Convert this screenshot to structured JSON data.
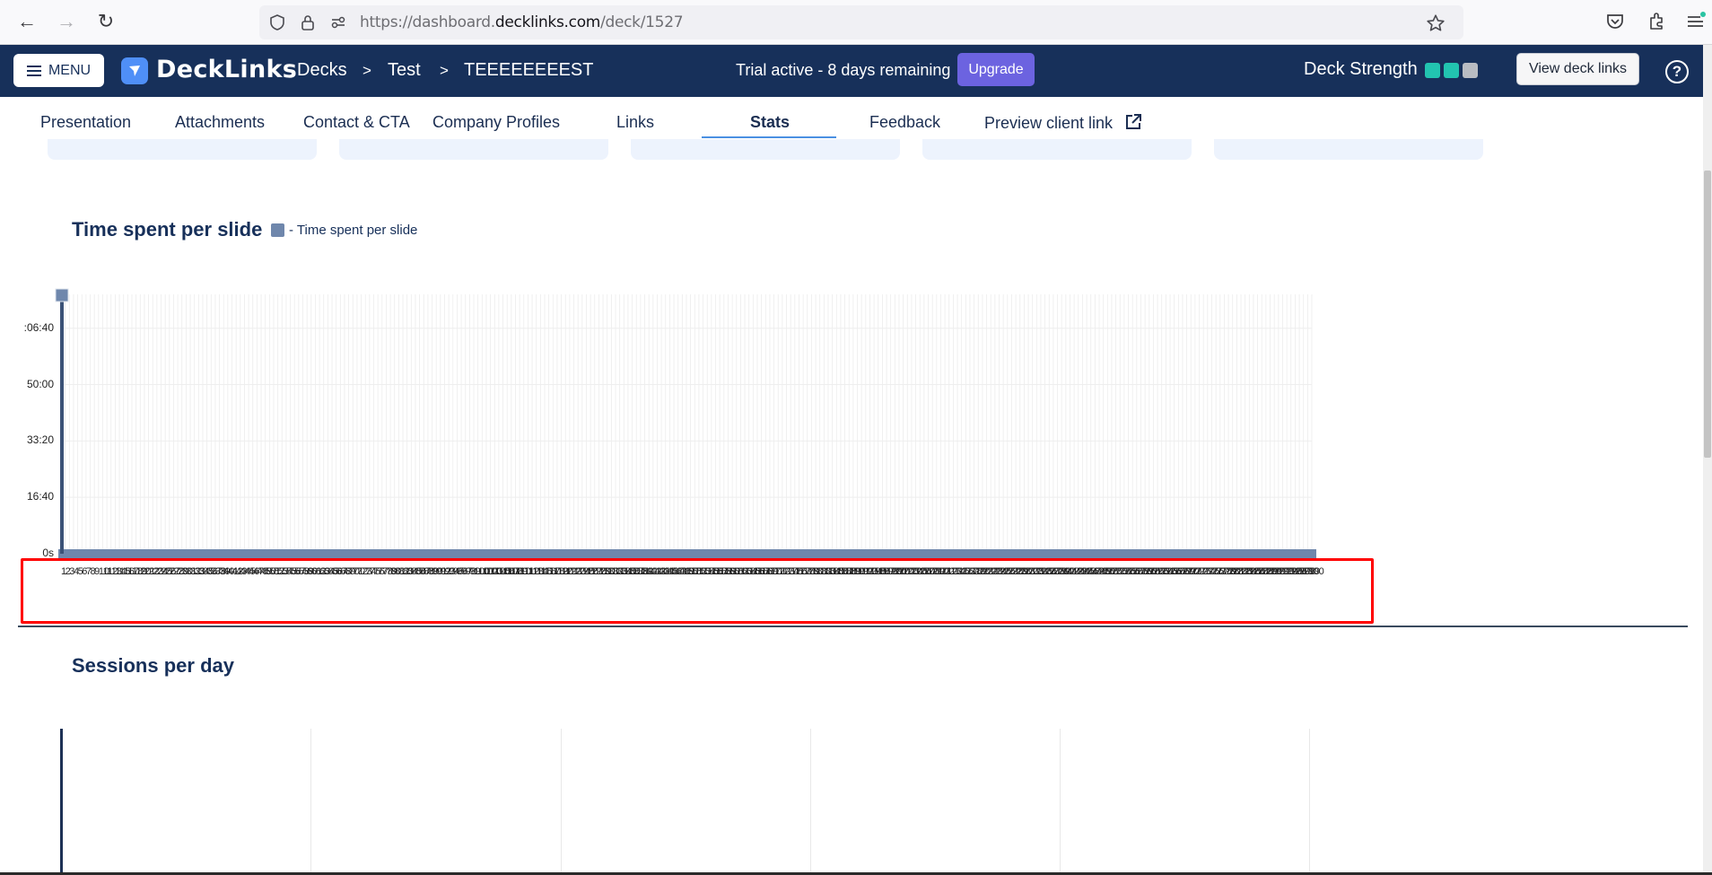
{
  "browser": {
    "url_prefix": "https://dashboard.",
    "url_domain": "decklinks.com",
    "url_path": "/deck/1527",
    "icons": [
      "back-icon",
      "forward-icon",
      "reload-icon",
      "shield-icon",
      "lock-icon",
      "permissions-icon",
      "bookmark-star-icon",
      "pocket-icon",
      "extensions-icon",
      "app-menu-icon"
    ]
  },
  "header": {
    "menu_label": "MENU",
    "logo_text": "DeckLinks",
    "breadcrumb": [
      "Decks",
      "Test",
      "TEEEEEEEEST"
    ],
    "breadcrumb_separator": ">",
    "trial_text": "Trial active - 8 days remaining",
    "upgrade_label": "Upgrade",
    "deck_strength_label": "Deck Strength",
    "deck_strength": {
      "filled": 2,
      "total": 3,
      "filled_color": "#22c4b0",
      "empty_color": "#b9bcc2"
    },
    "view_deck_links_label": "View deck links",
    "help_label": "?"
  },
  "tabs": [
    {
      "label": "Presentation",
      "active": false
    },
    {
      "label": "Attachments",
      "active": false
    },
    {
      "label": "Contact & CTA",
      "active": false
    },
    {
      "label": "Company Profiles",
      "active": false
    },
    {
      "label": "Links",
      "active": false
    },
    {
      "label": "Stats",
      "active": true
    },
    {
      "label": "Feedback",
      "active": false
    },
    {
      "label": "Preview client link",
      "active": false,
      "icon": "external-link-icon"
    }
  ],
  "colors": {
    "header_bg": "#17305a",
    "accent": "#4a90e2",
    "upgrade": "#6c63e0",
    "bar": "#6f87ac",
    "card_bg": "#edf3fd",
    "highlight": "#ff0000"
  },
  "chart_data": [
    {
      "type": "bar",
      "title": "Time spent per slide",
      "legend": [
        "- Time spent per slide"
      ],
      "legend_position": "top-left",
      "xlabel": "",
      "ylabel": "",
      "y_tick_labels": [
        "0s",
        "16:40",
        "33:20",
        "50:00",
        ":06:40"
      ],
      "y_tick_values_seconds": [
        0,
        1000,
        2000,
        3000,
        4000
      ],
      "ylim_seconds": [
        0,
        4600
      ],
      "x_tick_labels_note": "hundreds of overlapping slide-number labels (illegible)",
      "slide_count_approx": 300,
      "series": [
        {
          "name": "Time spent per slide",
          "values_seconds_first": [
            4600
          ],
          "values_seconds_rest": 0
        }
      ],
      "grid": true
    },
    {
      "type": "bar",
      "title": "Sessions per day",
      "series": [],
      "grid": true
    }
  ]
}
